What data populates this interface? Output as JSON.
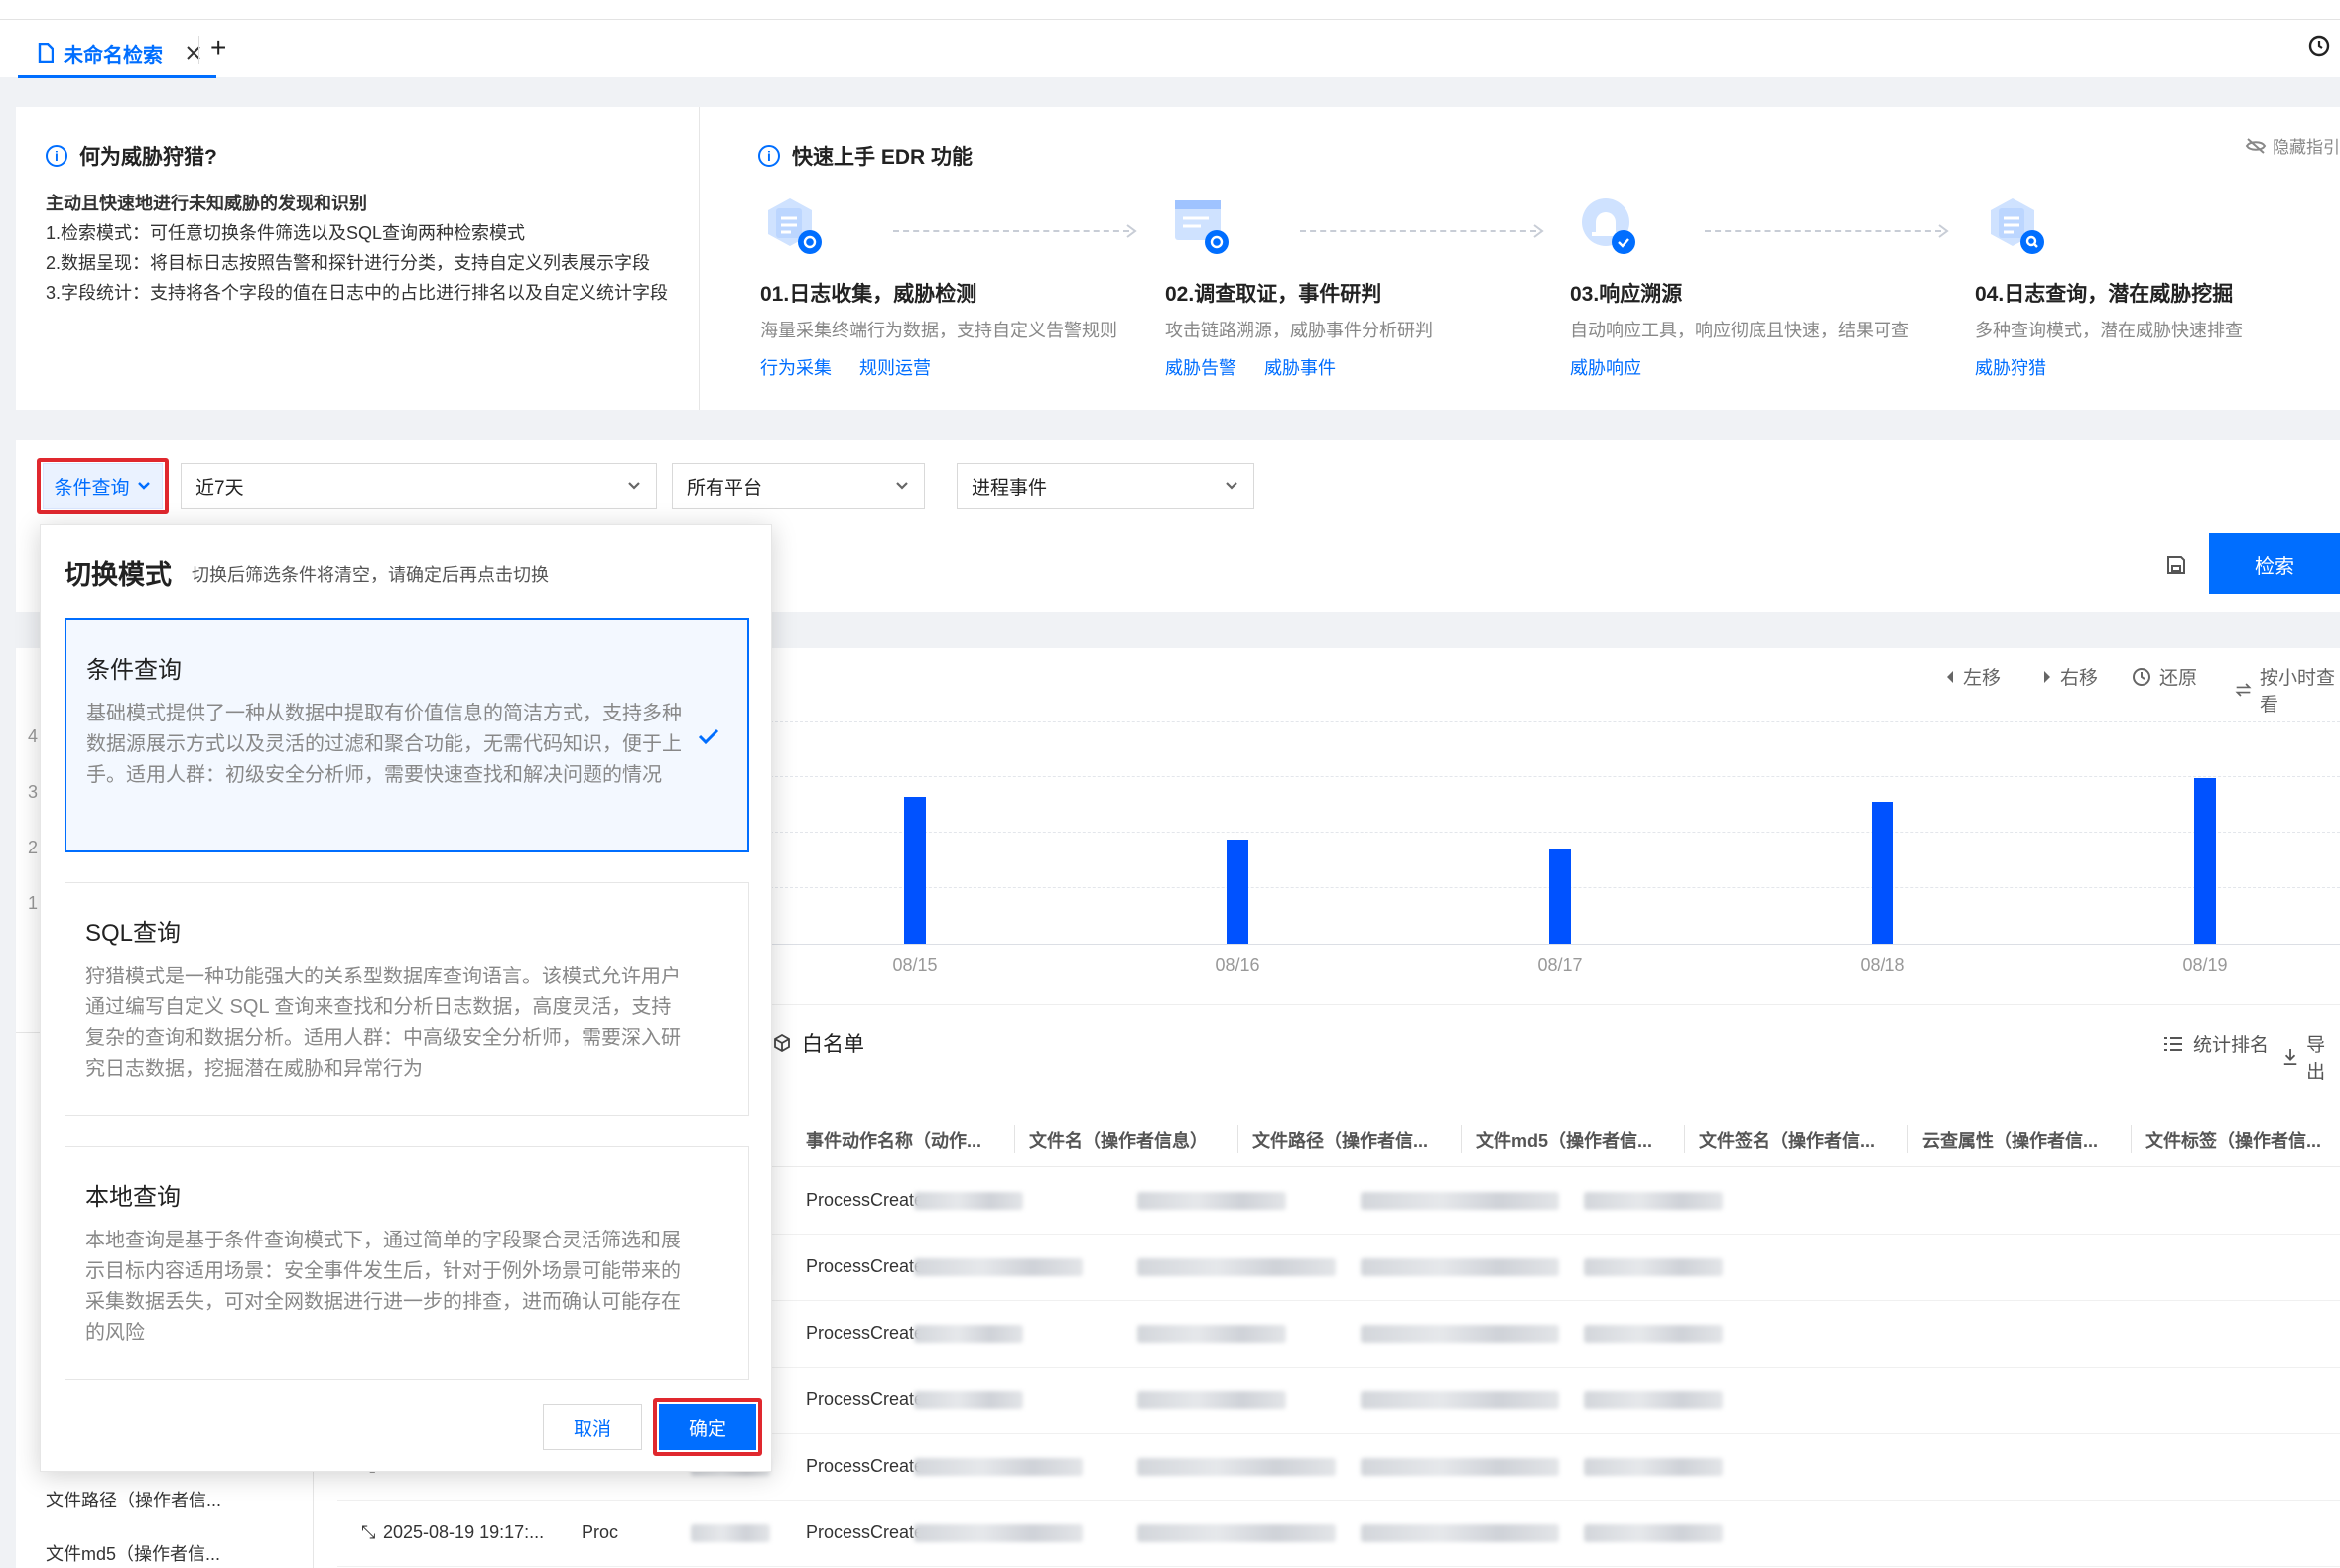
{
  "tabbar": {
    "tab_label": "未命名检索",
    "add_label": "+"
  },
  "guide": {
    "what": {
      "title": "何为威胁狩猎?",
      "lead": "主动且快速地进行未知威胁的发现和识别",
      "lines": [
        "1.检索模式：可任意切换条件筛选以及SQL查询两种检索模式",
        "2.数据呈现：将目标日志按照告警和探针进行分类，支持自定义列表展示字段",
        "3.字段统计：支持将各个字段的值在日志中的占比进行排名以及自定义统计字段"
      ]
    },
    "quick": {
      "title": "快速上手 EDR 功能",
      "hide_label": "隐藏指引",
      "steps": [
        {
          "title": "01.日志收集，威胁检测",
          "desc": "海量采集终端行为数据，支持自定义告警规则",
          "links": [
            "行为采集",
            "规则运营"
          ]
        },
        {
          "title": "02.调查取证，事件研判",
          "desc": "攻击链路溯源，威胁事件分析研判",
          "links": [
            "威胁告警",
            "威胁事件"
          ]
        },
        {
          "title": "03.响应溯源",
          "desc": "自动响应工具，响应彻底且快速，结果可查",
          "links": [
            "威胁响应"
          ]
        },
        {
          "title": "04.日志查询，潜在威胁挖掘",
          "desc": "多种查询模式，潜在威胁快速排查",
          "links": [
            "威胁狩猎"
          ]
        }
      ]
    }
  },
  "filters": {
    "mode": "条件查询",
    "time": "近7天",
    "platform": "所有平台",
    "event": "进程事件"
  },
  "search": {
    "button": "检索"
  },
  "chart_tools": {
    "left": "左移",
    "right": "右移",
    "reset": "还原",
    "hourly": "按小时查看"
  },
  "left_y_ticks": [
    "4",
    "3",
    "2",
    "1"
  ],
  "chart_data": {
    "type": "bar",
    "categories": [
      "08/15",
      "08/16",
      "08/17",
      "08/18",
      "08/19"
    ],
    "values": [
      3.1,
      2.2,
      2.0,
      3.0,
      3.5
    ],
    "ylim": [
      0,
      4.2
    ],
    "color": "#0052ff"
  },
  "results": {
    "whitelist_label": "白名单",
    "stats_label": "统计排名",
    "export_label": "导出",
    "columns": [
      "事件动作名称（动作...",
      "文件名（操作者信息）",
      "文件路径（操作者信...",
      "文件md5（操作者信...",
      "文件签名（操作者信...",
      "云查属性（操作者信...",
      "文件标签（操作者信..."
    ],
    "rows": [
      {
        "time": "",
        "proc": "",
        "action": "ProcessCreate"
      },
      {
        "time": "",
        "proc": "",
        "action": "ProcessCreate"
      },
      {
        "time": "",
        "proc": "",
        "action": "ProcessCreate"
      },
      {
        "time": "",
        "proc": "",
        "action": "ProcessCreate"
      },
      {
        "time": "2025-08-19 19:17:...",
        "proc": "Proc",
        "action": "ProcessCreate"
      },
      {
        "time": "2025-08-19 19:17:...",
        "proc": "Proc",
        "action": "ProcessCreate"
      }
    ]
  },
  "left_fields": [
    "文件路径（操作者信...",
    "文件md5（操作者信..."
  ],
  "popover": {
    "title": "切换模式",
    "hint": "切换后筛选条件将清空，请确定后再点击切换",
    "options": [
      {
        "title": "条件查询",
        "desc": "基础模式提供了一种从数据中提取有价值信息的简洁方式，支持多种数据源展示方式以及灵活的过滤和聚合功能，无需代码知识，便于上手。适用人群：初级安全分析师，需要快速查找和解决问题的情况",
        "selected": true
      },
      {
        "title": "SQL查询",
        "desc": "狩猎模式是一种功能强大的关系型数据库查询语言。该模式允许用户通过编写自定义 SQL 查询来查找和分析日志数据，高度灵活，支持复杂的查询和数据分析。适用人群：中高级安全分析师，需要深入研究日志数据，挖掘潜在威胁和异常行为",
        "selected": false
      },
      {
        "title": "本地查询",
        "desc": "本地查询是基于条件查询模式下，通过简单的字段聚合灵活筛选和展示目标内容适用场景：安全事件发生后，针对于例外场景可能带来的采集数据丢失，可对全网数据进行进一步的排查，进而确认可能存在的风险",
        "selected": false
      }
    ],
    "cancel": "取消",
    "ok": "确定"
  }
}
